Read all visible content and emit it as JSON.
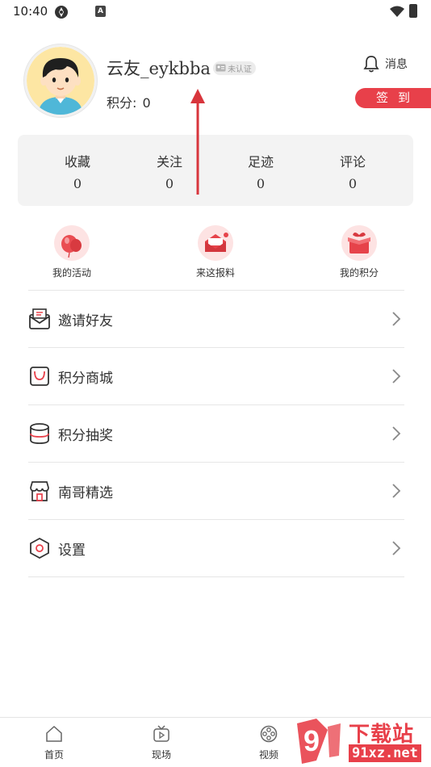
{
  "status_bar": {
    "time": "10:40"
  },
  "profile": {
    "username": "云友_eykbba",
    "verify_badge": "未认证",
    "points_label": "积分:",
    "points_value": "0",
    "message_label": "消息",
    "checkin_label": "签到"
  },
  "stats": [
    {
      "label": "收藏",
      "value": "0"
    },
    {
      "label": "关注",
      "value": "0"
    },
    {
      "label": "足迹",
      "value": "0"
    },
    {
      "label": "评论",
      "value": "0"
    }
  ],
  "quick_actions": [
    {
      "label": "我的活动",
      "icon": "balloon-icon"
    },
    {
      "label": "来这报料",
      "icon": "mailbox-icon"
    },
    {
      "label": "我的积分",
      "icon": "giftbox-icon"
    }
  ],
  "menu": [
    {
      "label": "邀请好友",
      "icon": "envelope-icon"
    },
    {
      "label": "积分商城",
      "icon": "shopping-bag-icon"
    },
    {
      "label": "积分抽奖",
      "icon": "database-icon"
    },
    {
      "label": "南哥精选",
      "icon": "store-icon"
    },
    {
      "label": "设置",
      "icon": "settings-hexagon-icon"
    }
  ],
  "bottom_nav": [
    {
      "label": "首页",
      "icon": "home-icon"
    },
    {
      "label": "现场",
      "icon": "tv-icon"
    },
    {
      "label": "视频",
      "icon": "film-reel-icon"
    }
  ],
  "watermark": {
    "brand": "下载站",
    "url": "91xz.net",
    "logo_digits": "9"
  },
  "colors": {
    "accent": "#e8404a",
    "card_bg": "#f3f3f3",
    "divider": "#e6e6e6"
  }
}
